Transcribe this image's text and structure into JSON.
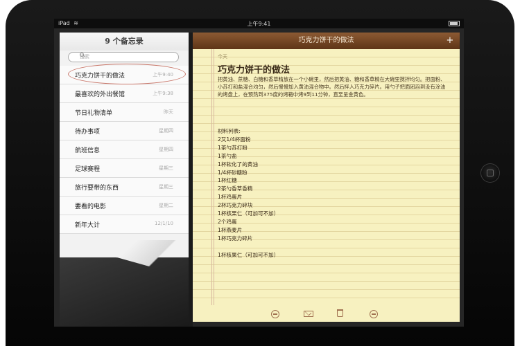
{
  "status_bar": {
    "carrier": "iPad",
    "time": "上午9:41"
  },
  "master": {
    "title": "9 个备忘录",
    "search_placeholder": "搜索",
    "notes": [
      {
        "title": "巧克力饼干的做法",
        "date": "上午9:40"
      },
      {
        "title": "最喜欢的外出餐馆",
        "date": "上午9:38"
      },
      {
        "title": "节日礼物清单",
        "date": "昨天"
      },
      {
        "title": "待办事项",
        "date": "星期四"
      },
      {
        "title": "航班信息",
        "date": "星期四"
      },
      {
        "title": "足球赛程",
        "date": "星期三"
      },
      {
        "title": "旅行要带的东西",
        "date": "星期三"
      },
      {
        "title": "要看的电影",
        "date": "星期二"
      },
      {
        "title": "新年大计",
        "date": "12/1/10"
      }
    ]
  },
  "detail": {
    "toolbar_title": "巧克力饼干的做法",
    "add_label": "+",
    "date_label": "今天",
    "heading": "巧克力饼干的做法",
    "body": "把黄油、蔗糖、白糖和香草精放在一个小碗里，然后把黄油、糖和香草精在大碗里搅拌均匀。把面粉、小苏打和盐混合均匀，然后慢慢加入黄油混合物中。然后拌入巧克力碎片。用勺子把面团舀到没有涂油的烤盘上，在预热到375度的烤箱中烤9到11分钟，直至呈金黄色。",
    "ingredients_title": "材料列表:",
    "ingredients": [
      "2又1/4杯面粉",
      "1茶勺苏打粉",
      "1茶勺盐",
      "1杯软化了的黄油",
      "1/4杯砂糖粉",
      "1杯红糖",
      "2茶勺香草香精",
      "1杯鸡蛋片",
      "2杯巧克力碎块",
      "1杯核果仁（可加可不加）",
      "2个鸡蛋",
      "1杯燕麦片",
      "1杯巧克力碎片",
      "",
      "1杯核果仁（可加可不加）"
    ]
  },
  "colors": {
    "toolbar": "#6f4321",
    "paper": "#f7f1c0",
    "accent": "#a07050"
  }
}
